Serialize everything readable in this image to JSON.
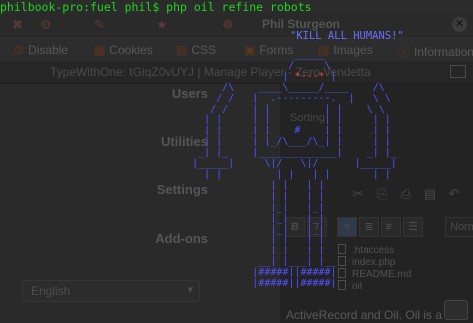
{
  "terminal": {
    "prompt": "philbook-pro:fuel phil$ ",
    "command": "php oil refine robots",
    "quote": "\"KILL ALL HUMANS!\"",
    "robot_lines": [
      "                     _____",
      "                    /     \\",
      "                   | *---* |",
      "         /\\    ____\\_____/____    /\\",
      "        / /   |  .---------.  |   \\ \\",
      "       / /    | |         | |    \\ \\",
      "      | |     | |         | |     | |",
      "      | |     | |    #    | |     | |",
      "      | |     | |_/\\___/\\_| |     | |",
      "     _| |_    |_____________|    _| |_",
      "    |_____|     \\|/   \\|/      |_____|",
      "      | |         | |   | |       | |",
      "                 | |   | |",
      "                 | |   | |",
      "                 |_|   |_|",
      "                 |_|   |_|",
      "                 |_|   |_|",
      "                 | |   | |",
      "                 | |   | |",
      "               __| |___| |__",
      "              |#####||#####|",
      "              |#####||#####|"
    ],
    "robot_eyes": "*---*"
  },
  "browser": {
    "user_name": "Phil Sturgeon",
    "close_glyph": "✕",
    "toolbar_icons": [
      "✖",
      "⚙",
      "✎",
      "★",
      "☸"
    ],
    "devbar": [
      {
        "icon": "⊘",
        "label": "Disable"
      },
      {
        "icon": "▦",
        "label": "Cookies"
      },
      {
        "icon": "▤",
        "label": "CSS"
      },
      {
        "icon": "▣",
        "label": "Forms"
      },
      {
        "icon": "▨",
        "label": "Images"
      },
      {
        "icon": "ⓘ",
        "label": "Information"
      }
    ],
    "address": "TypeWithOne: tGiqZ0vUYJ  |  Manage Player - Zero Vendetta",
    "nav": [
      "Users",
      "Utilities",
      "Settings",
      "Add-ons"
    ],
    "language": "English",
    "right_field": "Sorting",
    "editor_icons": [
      "✂",
      "⎘",
      "⎙",
      "▤",
      "↶"
    ],
    "format_buttons": [
      "B",
      "I"
    ],
    "align_buttons": [
      "≡",
      "≣",
      "≢",
      "☰"
    ],
    "format_select": "Normal",
    "files": [
      ".htaccess",
      "index.php",
      "README.md",
      "oil"
    ],
    "bottom_text": "ActiveRecord and Oil. Oil is a slick"
  }
}
